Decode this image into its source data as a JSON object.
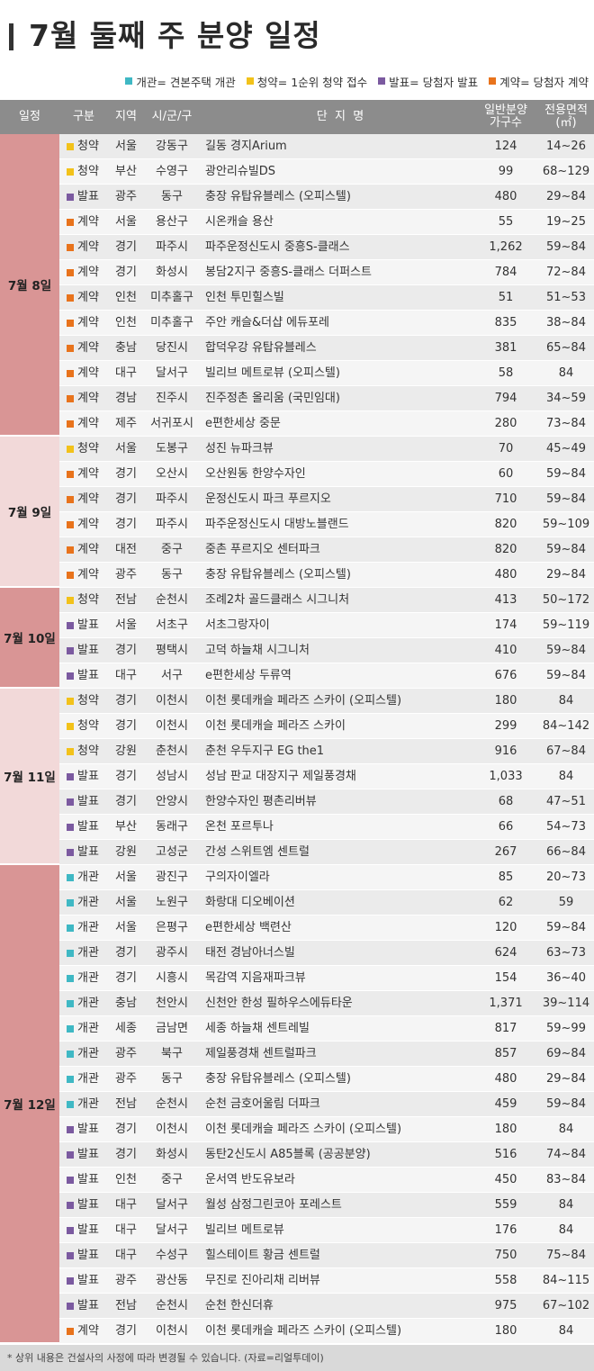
{
  "title": "7월 둘째 주 분양 일정",
  "legend": [
    {
      "label": "개관= 견본주택 개관",
      "color": "#3fb8c4"
    },
    {
      "label": "청약= 1순위 청약 접수",
      "color": "#f2c21a"
    },
    {
      "label": "발표= 당첨자 발표",
      "color": "#7b5aa0"
    },
    {
      "label": "계약= 당첨자 계약",
      "color": "#e8731c"
    }
  ],
  "type_colors": {
    "개관": "#3fb8c4",
    "청약": "#f2c21a",
    "발표": "#7b5aa0",
    "계약": "#e8731c"
  },
  "headers": {
    "date": "일정",
    "type": "구분",
    "region": "지역",
    "city": "시/군/구",
    "name": "단  지  명",
    "units_line1": "일반분양",
    "units_line2": "가구수",
    "area_line1": "전용면적",
    "area_line2": "(㎡)"
  },
  "dates": [
    {
      "label": "7월 8일",
      "rows": 12,
      "color": "#d99595"
    },
    {
      "label": "7월 9일",
      "rows": 6,
      "color": "#f2d9d9"
    },
    {
      "label": "7월 10일",
      "rows": 4,
      "color": "#d99595"
    },
    {
      "label": "7월 11일",
      "rows": 7,
      "color": "#f2d9d9"
    },
    {
      "label": "7월 12일",
      "rows": 19,
      "color": "#d99595"
    }
  ],
  "rows": [
    {
      "type": "청약",
      "region": "서울",
      "city": "강동구",
      "name": "길동 경지Arium",
      "units": "124",
      "area": "14~26"
    },
    {
      "type": "청약",
      "region": "부산",
      "city": "수영구",
      "name": "광안리슈빌DS",
      "units": "99",
      "area": "68~129"
    },
    {
      "type": "발표",
      "region": "광주",
      "city": "동구",
      "name": "충장 유탑유블레스 (오피스텔)",
      "units": "480",
      "area": "29~84"
    },
    {
      "type": "계약",
      "region": "서울",
      "city": "용산구",
      "name": "시온캐슬 용산",
      "units": "55",
      "area": "19~25"
    },
    {
      "type": "계약",
      "region": "경기",
      "city": "파주시",
      "name": "파주운정신도시 중흥S-클래스",
      "units": "1,262",
      "area": "59~84"
    },
    {
      "type": "계약",
      "region": "경기",
      "city": "화성시",
      "name": "봉담2지구 중흥S-클래스 더퍼스트",
      "units": "784",
      "area": "72~84"
    },
    {
      "type": "계약",
      "region": "인천",
      "city": "미추홀구",
      "name": "인천 투민힐스빌",
      "units": "51",
      "area": "51~53"
    },
    {
      "type": "계약",
      "region": "인천",
      "city": "미추홀구",
      "name": "주안 캐슬&더샵 에듀포레",
      "units": "835",
      "area": "38~84"
    },
    {
      "type": "계약",
      "region": "충남",
      "city": "당진시",
      "name": "합덕우강 유탑유블레스",
      "units": "381",
      "area": "65~84"
    },
    {
      "type": "계약",
      "region": "대구",
      "city": "달서구",
      "name": "빌리브 메트로뷰 (오피스텔)",
      "units": "58",
      "area": "84"
    },
    {
      "type": "계약",
      "region": "경남",
      "city": "진주시",
      "name": "진주정촌 올리움 (국민임대)",
      "units": "794",
      "area": "34~59"
    },
    {
      "type": "계약",
      "region": "제주",
      "city": "서귀포시",
      "name": "e편한세상 중문",
      "units": "280",
      "area": "73~84"
    },
    {
      "type": "청약",
      "region": "서울",
      "city": "도봉구",
      "name": "성진 뉴파크뷰",
      "units": "70",
      "area": "45~49"
    },
    {
      "type": "계약",
      "region": "경기",
      "city": "오산시",
      "name": "오산원동 한양수자인",
      "units": "60",
      "area": "59~84"
    },
    {
      "type": "계약",
      "region": "경기",
      "city": "파주시",
      "name": "운정신도시 파크 푸르지오",
      "units": "710",
      "area": "59~84"
    },
    {
      "type": "계약",
      "region": "경기",
      "city": "파주시",
      "name": "파주운정신도시 대방노블랜드",
      "units": "820",
      "area": "59~109"
    },
    {
      "type": "계약",
      "region": "대전",
      "city": "중구",
      "name": "중촌 푸르지오 센터파크",
      "units": "820",
      "area": "59~84"
    },
    {
      "type": "계약",
      "region": "광주",
      "city": "동구",
      "name": "충장 유탑유블레스 (오피스텔)",
      "units": "480",
      "area": "29~84"
    },
    {
      "type": "청약",
      "region": "전남",
      "city": "순천시",
      "name": "조례2차 골드클래스 시그니처",
      "units": "413",
      "area": "50~172"
    },
    {
      "type": "발표",
      "region": "서울",
      "city": "서초구",
      "name": "서초그랑자이",
      "units": "174",
      "area": "59~119"
    },
    {
      "type": "발표",
      "region": "경기",
      "city": "평택시",
      "name": "고덕 하늘채 시그니처",
      "units": "410",
      "area": "59~84"
    },
    {
      "type": "발표",
      "region": "대구",
      "city": "서구",
      "name": "e편한세상 두류역",
      "units": "676",
      "area": "59~84"
    },
    {
      "type": "청약",
      "region": "경기",
      "city": "이천시",
      "name": "이천 롯데캐슬 페라즈 스카이 (오피스텔)",
      "units": "180",
      "area": "84"
    },
    {
      "type": "청약",
      "region": "경기",
      "city": "이천시",
      "name": "이천 롯데캐슬 페라즈 스카이",
      "units": "299",
      "area": "84~142"
    },
    {
      "type": "청약",
      "region": "강원",
      "city": "춘천시",
      "name": "춘천 우두지구 EG the1",
      "units": "916",
      "area": "67~84"
    },
    {
      "type": "발표",
      "region": "경기",
      "city": "성남시",
      "name": "성남 판교 대장지구 제일풍경채",
      "units": "1,033",
      "area": "84"
    },
    {
      "type": "발표",
      "region": "경기",
      "city": "안양시",
      "name": "한양수자인 평촌리버뷰",
      "units": "68",
      "area": "47~51"
    },
    {
      "type": "발표",
      "region": "부산",
      "city": "동래구",
      "name": "온천 포르투나",
      "units": "66",
      "area": "54~73"
    },
    {
      "type": "발표",
      "region": "강원",
      "city": "고성군",
      "name": "간성 스위트엠 센트럴",
      "units": "267",
      "area": "66~84"
    },
    {
      "type": "개관",
      "region": "서울",
      "city": "광진구",
      "name": "구의자이엘라",
      "units": "85",
      "area": "20~73"
    },
    {
      "type": "개관",
      "region": "서울",
      "city": "노원구",
      "name": "화랑대 디오베이션",
      "units": "62",
      "area": "59"
    },
    {
      "type": "개관",
      "region": "서울",
      "city": "은평구",
      "name": "e편한세상 백련산",
      "units": "120",
      "area": "59~84"
    },
    {
      "type": "개관",
      "region": "경기",
      "city": "광주시",
      "name": "태전 경남아너스빌",
      "units": "624",
      "area": "63~73"
    },
    {
      "type": "개관",
      "region": "경기",
      "city": "시흥시",
      "name": "목감역 지음재파크뷰",
      "units": "154",
      "area": "36~40"
    },
    {
      "type": "개관",
      "region": "충남",
      "city": "천안시",
      "name": "신천안 한성 필하우스에듀타운",
      "units": "1,371",
      "area": "39~114"
    },
    {
      "type": "개관",
      "region": "세종",
      "city": "금남면",
      "name": "세종 하늘채 센트레빌",
      "units": "817",
      "area": "59~99"
    },
    {
      "type": "개관",
      "region": "광주",
      "city": "북구",
      "name": "제일풍경채 센트럴파크",
      "units": "857",
      "area": "69~84"
    },
    {
      "type": "개관",
      "region": "광주",
      "city": "동구",
      "name": "충장 유탑유블레스 (오피스텔)",
      "units": "480",
      "area": "29~84"
    },
    {
      "type": "개관",
      "region": "전남",
      "city": "순천시",
      "name": "순천 금호어울림 더파크",
      "units": "459",
      "area": "59~84"
    },
    {
      "type": "발표",
      "region": "경기",
      "city": "이천시",
      "name": "이천 롯데캐슬 페라즈 스카이 (오피스텔)",
      "units": "180",
      "area": "84"
    },
    {
      "type": "발표",
      "region": "경기",
      "city": "화성시",
      "name": "동탄2신도시 A85블록 (공공분양)",
      "units": "516",
      "area": "74~84"
    },
    {
      "type": "발표",
      "region": "인천",
      "city": "중구",
      "name": "운서역 반도유보라",
      "units": "450",
      "area": "83~84"
    },
    {
      "type": "발표",
      "region": "대구",
      "city": "달서구",
      "name": "월성 삼정그린코아 포레스트",
      "units": "559",
      "area": "84"
    },
    {
      "type": "발표",
      "region": "대구",
      "city": "달서구",
      "name": "빌리브 메트로뷰",
      "units": "176",
      "area": "84"
    },
    {
      "type": "발표",
      "region": "대구",
      "city": "수성구",
      "name": "힐스테이트 황금 센트럴",
      "units": "750",
      "area": "75~84"
    },
    {
      "type": "발표",
      "region": "광주",
      "city": "광산동",
      "name": "무진로 진아리채 리버뷰",
      "units": "558",
      "area": "84~115"
    },
    {
      "type": "발표",
      "region": "전남",
      "city": "순천시",
      "name": "순천 한신더휴",
      "units": "975",
      "area": "67~102"
    },
    {
      "type": "계약",
      "region": "경기",
      "city": "이천시",
      "name": "이천 롯데캐슬 페라즈 스카이 (오피스텔)",
      "units": "180",
      "area": "84"
    }
  ],
  "footnote": "* 상위 내용은 건설사의 사정에 따라 변경될 수 있습니다. (자료=리얼투데이)"
}
